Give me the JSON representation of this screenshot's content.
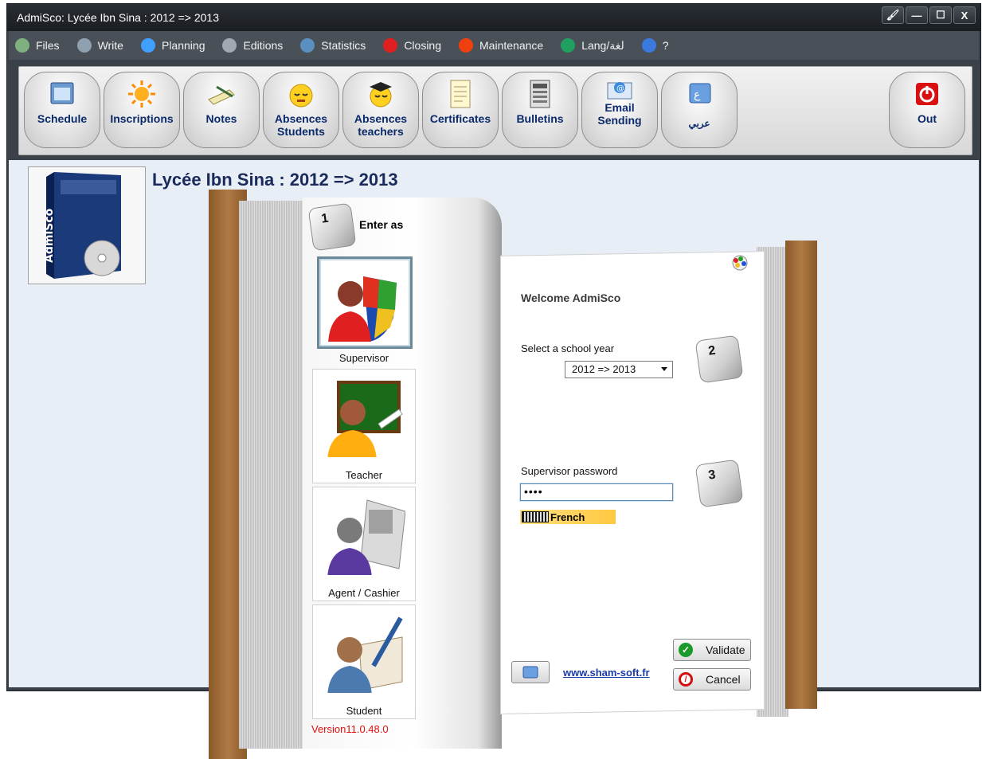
{
  "window": {
    "title": "AdmiSco: Lycée Ibn Sina : 2012 => 2013",
    "btn_min": "—",
    "btn_max": "☐",
    "btn_close": "X"
  },
  "menu": [
    {
      "label": "Files",
      "icon": "files-icon",
      "color": "#7fb07f"
    },
    {
      "label": "Write",
      "icon": "write-icon",
      "color": "#8fa0b0"
    },
    {
      "label": "Planning",
      "icon": "planning-icon",
      "color": "#40a0ff"
    },
    {
      "label": "Editions",
      "icon": "editions-icon",
      "color": "#a0a8b0"
    },
    {
      "label": "Statistics",
      "icon": "statistics-icon",
      "color": "#5a90c0"
    },
    {
      "label": "Closing",
      "icon": "closing-icon",
      "color": "#e02020"
    },
    {
      "label": "Maintenance",
      "icon": "maintenance-icon",
      "color": "#f04010"
    },
    {
      "label": "Lang/لغة",
      "icon": "globe-icon",
      "color": "#20a060"
    },
    {
      "label": "?",
      "icon": "help-icon",
      "color": "#3a7adf"
    }
  ],
  "toolbar": {
    "schedule": "Schedule",
    "inscriptions": "Inscriptions",
    "notes": "Notes",
    "absences_students_1": "Absences",
    "absences_students_2": "Students",
    "absences_teachers_1": "Absences",
    "absences_teachers_2": "teachers",
    "certificates": "Certificates",
    "bulletins": "Bulletins",
    "email_1": "Email",
    "email_2": "Sending",
    "arabic": "عربي",
    "out": "Out"
  },
  "main": {
    "school_title": "Lycée Ibn Sina : 2012 => 2013",
    "logo_text": "AdmiSco"
  },
  "login": {
    "step1": "1",
    "step2": "2",
    "step3": "3",
    "enter_as": "Enter as",
    "roles": [
      "Supervisor",
      "Teacher",
      "Agent / Cashier",
      "Student"
    ],
    "selected_role": "Supervisor",
    "version": "Version11.0.48.0",
    "welcome": "Welcome AdmiSco",
    "school_year_label": "Select a school year",
    "school_year_value": "2012 => 2013",
    "password_label": "Supervisor password",
    "password_value": "••••",
    "keyboard_lang": "French",
    "validate": "Validate",
    "cancel": "Cancel",
    "website": "www.sham-soft.fr"
  }
}
